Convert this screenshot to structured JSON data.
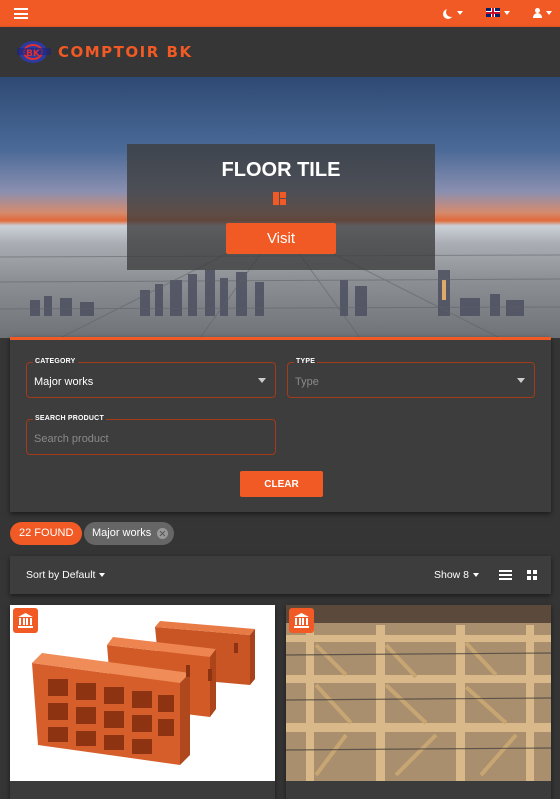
{
  "topbar": {
    "menu_icon": "hamburger-icon",
    "theme_icon": "moon-icon",
    "language_icon": "uk-flag-icon",
    "account_icon": "user-icon",
    "accent": "#f15a24"
  },
  "header": {
    "logo_text": "COMPTOIR BK"
  },
  "hero": {
    "title": "FLOOR TILE",
    "icon": "grid-icon",
    "visit_label": "Visit"
  },
  "filters": {
    "category_label": "CATEGORY",
    "category_value": "Major works",
    "type_label": "TYPE",
    "type_placeholder": "Type",
    "search_label": "SEARCH PRODUCT",
    "search_placeholder": "Search product",
    "clear_label": "CLEAR"
  },
  "results": {
    "found_label": "22 FOUND",
    "active_filter": "Major works"
  },
  "toolbar": {
    "sort_label": "Sort by Default",
    "show_label": "Show 8",
    "list_view_icon": "list-icon",
    "grid_view_icon": "grid-icon"
  },
  "products": [
    {
      "image": "hollow-bricks",
      "badge_icon": "bank-icon"
    },
    {
      "image": "foundation-formwork",
      "badge_icon": "bank-icon"
    }
  ]
}
